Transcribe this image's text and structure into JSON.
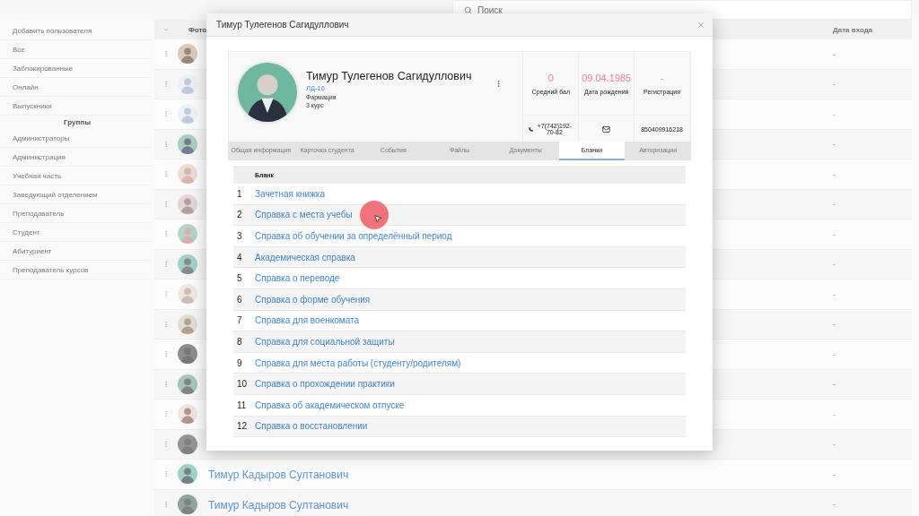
{
  "search": {
    "placeholder": "Поиск"
  },
  "sidebar": {
    "items": [
      "Добавить пользователя",
      "Все",
      "Заблокированные",
      "Онлайн",
      "Выпускники"
    ],
    "group_heading": "Группы",
    "group_items": [
      "Администраторы",
      "Администрация",
      "Учебная часть",
      "Заведующий отделением",
      "Преподаватель",
      "Студент",
      "Абитуриент",
      "Преподаватель курсов"
    ]
  },
  "table": {
    "columns": [
      "Фото",
      "Дата входа"
    ],
    "rows": [
      {
        "last_login": "-"
      },
      {
        "last_login": "-"
      },
      {
        "last_login": "-"
      },
      {
        "last_login": "-"
      },
      {
        "last_login": "-"
      },
      {
        "last_login": "-"
      },
      {
        "last_login": "-"
      },
      {
        "last_login": "-"
      },
      {
        "last_login": "-"
      },
      {
        "last_login": "-"
      },
      {
        "last_login": "-"
      },
      {
        "last_login": "-"
      },
      {
        "last_login": "-"
      },
      {
        "last_login": "-"
      },
      {
        "name": "Тимур Кадыров Султанович",
        "last_login": "-"
      },
      {
        "name": "Тимур Кадыров Султанович",
        "last_login": "-"
      }
    ]
  },
  "modal": {
    "title": "Тимур Тулегенов Сагидуллович",
    "profile": {
      "name": "Тимур Тулегенов Сагидуллович",
      "group": "ЛД-16",
      "faculty": "Фармация",
      "course": "3 курс"
    },
    "stats": [
      {
        "value": "0",
        "label": "Средний бал"
      },
      {
        "value": "09.04.1985",
        "label": "Дата рождения"
      },
      {
        "value": "-",
        "label": "Регистрация"
      }
    ],
    "contacts": [
      {
        "kind": "phone",
        "text": "+7(742)192-70-82"
      },
      {
        "kind": "email"
      },
      {
        "kind": "text",
        "text": "850409916218"
      }
    ],
    "tabs": [
      {
        "label": "Общая информация",
        "selected": false
      },
      {
        "label": "Карточка студента",
        "selected": false
      },
      {
        "label": "События",
        "selected": false
      },
      {
        "label": "Файлы",
        "selected": false
      },
      {
        "label": "Документы",
        "selected": false
      },
      {
        "label": "Бланки",
        "selected": true
      },
      {
        "label": "Авторизации",
        "selected": false
      }
    ],
    "blanks": {
      "column": "Бланк",
      "rows": [
        {
          "number": "1",
          "title": "Зачетная книжка"
        },
        {
          "number": "2",
          "title": "Справка с места учебы"
        },
        {
          "number": "3",
          "title": "Справка об обучении за определённый период"
        },
        {
          "number": "4",
          "title": "Академическая справка"
        },
        {
          "number": "5",
          "title": "Справка о переводе"
        },
        {
          "number": "6",
          "title": "Справка о форме обучения"
        },
        {
          "number": "7",
          "title": "Справка для военкомата"
        },
        {
          "number": "8",
          "title": "Справка для социальной защиты"
        },
        {
          "number": "9",
          "title": "Справка для места работы (студенту/родителям)"
        },
        {
          "number": "10",
          "title": "Справка о прохождении практики"
        },
        {
          "number": "11",
          "title": "Справка об академическом отпуске"
        },
        {
          "number": "12",
          "title": "Справка о восстановлении"
        }
      ]
    }
  }
}
